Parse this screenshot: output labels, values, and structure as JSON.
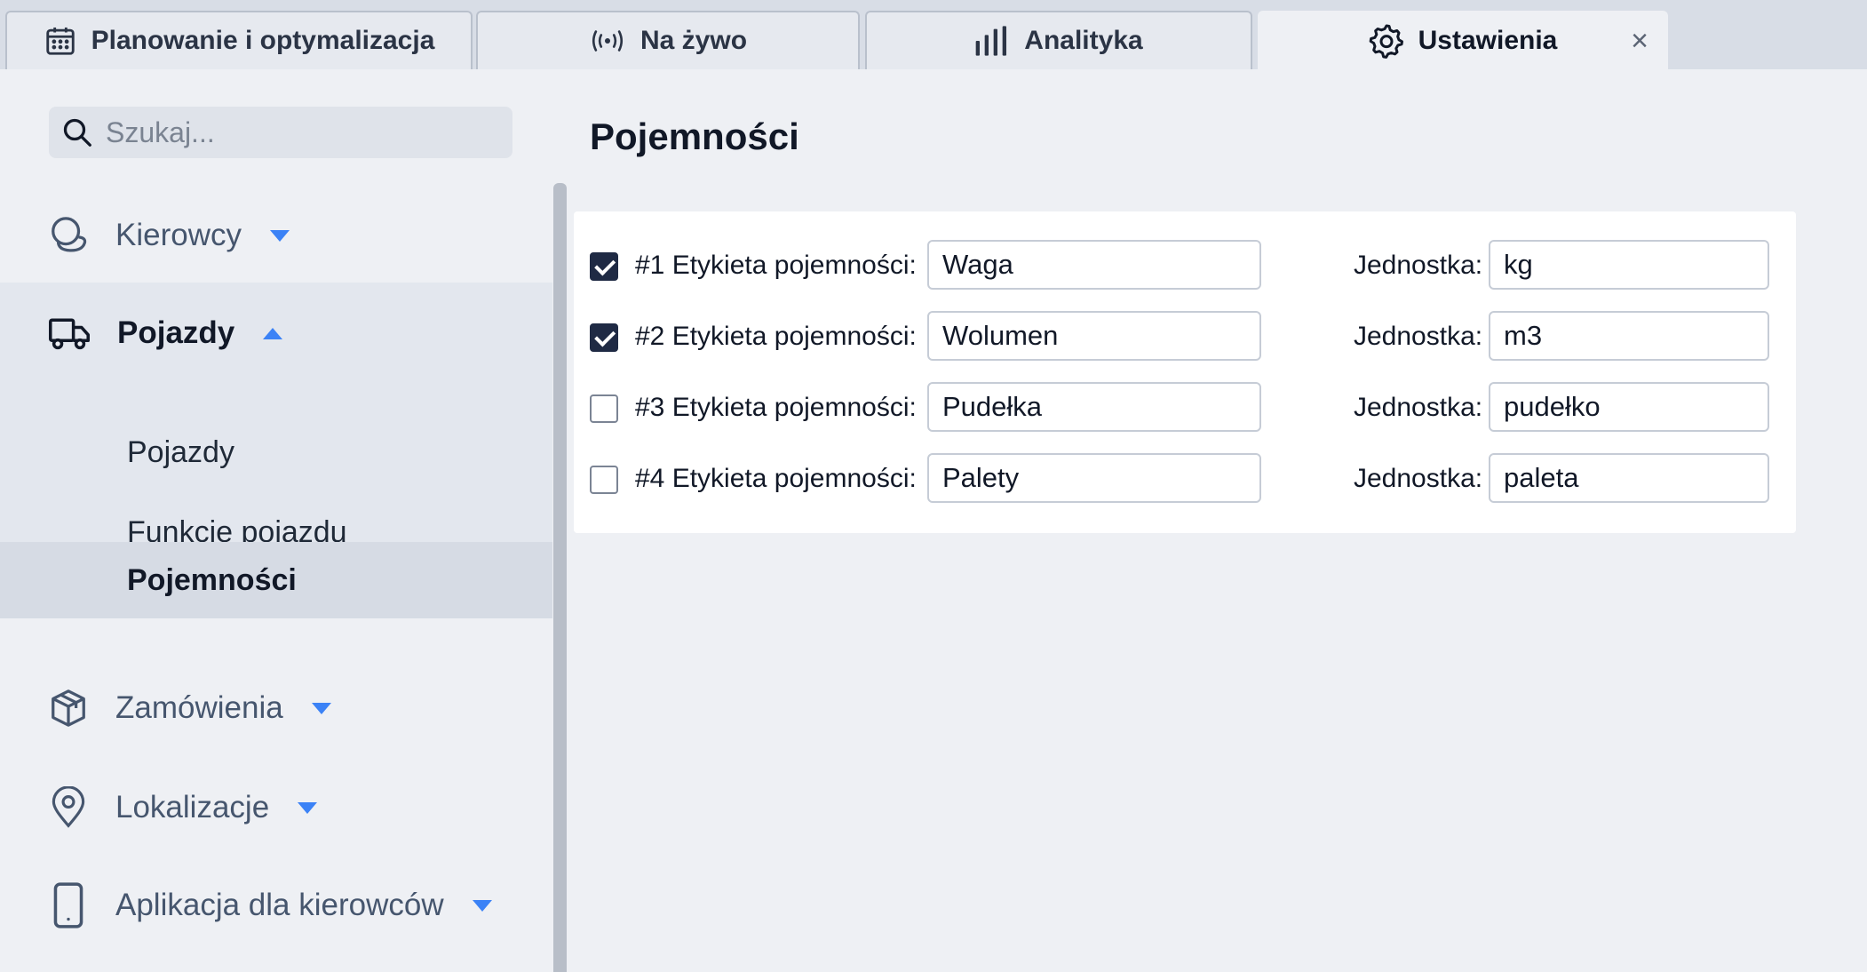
{
  "tabs": [
    {
      "label": "Planowanie i optymalizacja",
      "icon": "calendar-icon",
      "active": false
    },
    {
      "label": "Na żywo",
      "icon": "live-broadcast-icon",
      "active": false
    },
    {
      "label": "Analityka",
      "icon": "bar-chart-icon",
      "active": false
    },
    {
      "label": "Ustawienia",
      "icon": "gear-icon",
      "active": true
    }
  ],
  "tab_close_symbol": "×",
  "sidebar": {
    "search_placeholder": "Szukaj...",
    "items": [
      {
        "label": "Kierowcy",
        "icon": "driver-icon",
        "expanded": false
      },
      {
        "label": "Pojazdy",
        "icon": "truck-icon",
        "expanded": true,
        "children": [
          {
            "label": "Pojazdy",
            "selected": false
          },
          {
            "label": "Funkcje pojazdu",
            "selected": false
          },
          {
            "label": "Pojemności",
            "selected": true
          }
        ]
      },
      {
        "label": "Zamówienia",
        "icon": "box-icon",
        "expanded": false
      },
      {
        "label": "Lokalizacje",
        "icon": "location-pin-icon",
        "expanded": false
      },
      {
        "label": "Aplikacja dla kierowców",
        "icon": "phone-icon",
        "expanded": false
      }
    ]
  },
  "main": {
    "title": "Pojemności",
    "unit_label": "Jednostka:",
    "capacities": [
      {
        "label": "#1 Etykieta pojemności:",
        "value": "Waga",
        "unit": "kg",
        "enabled": true
      },
      {
        "label": "#2 Etykieta pojemności:",
        "value": "Wolumen",
        "unit": "m3",
        "enabled": true
      },
      {
        "label": "#3 Etykieta pojemności:",
        "value": "Pudełka",
        "unit": "pudełko",
        "enabled": false
      },
      {
        "label": "#4 Etykieta pojemności:",
        "value": "Palety",
        "unit": "paleta",
        "enabled": false
      }
    ]
  },
  "colors": {
    "accent": "#3b82f6",
    "checkbox_checked": "#1f2a44",
    "sidebar_selected": "#d6dbe4"
  }
}
